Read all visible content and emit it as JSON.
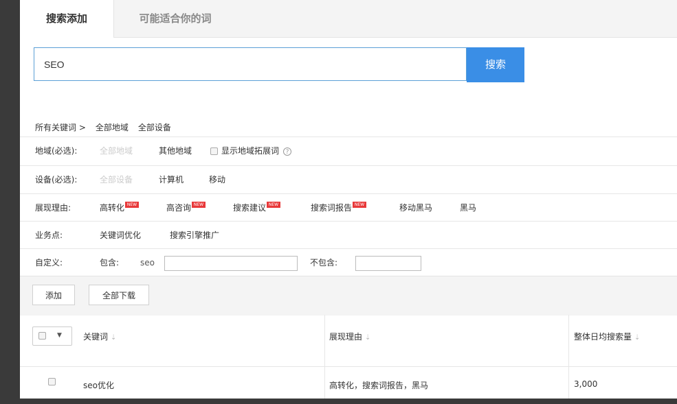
{
  "tabs": [
    {
      "label": "搜索添加"
    },
    {
      "label": "可能适合你的词"
    }
  ],
  "search": {
    "value": "SEO",
    "button_label": "搜索"
  },
  "breadcrumb": [
    "所有关键词 >",
    "全部地域",
    "全部设备"
  ],
  "filters": {
    "region": {
      "label": "地域(必选):",
      "all": "全部地域",
      "other": "其他地域",
      "show_expand": "显示地域拓展词"
    },
    "device": {
      "label": "设备(必选):",
      "all": "全部设备",
      "pc": "计算机",
      "mobile": "移动"
    },
    "reason": {
      "label": "展现理由:",
      "items": [
        "高转化",
        "高咨询",
        "搜索建议",
        "搜索词报告",
        "移动黑马",
        "黑马"
      ]
    },
    "business": {
      "label": "业务点:",
      "items": [
        "关键词优化",
        "搜索引擎推广"
      ]
    },
    "custom": {
      "label": "自定义:",
      "include_label": "包含:",
      "include_value": "seo",
      "exclude_label": "不包含:"
    }
  },
  "toolbar": {
    "add_label": "添加",
    "download_label": "全部下载"
  },
  "table": {
    "columns": [
      "关键词",
      "展现理由",
      "整体日均搜索量"
    ],
    "rows": [
      {
        "keyword": "seo优化",
        "reason": "高转化，搜索词报告，黑马",
        "volume": "3,000"
      }
    ]
  },
  "colors": {
    "accent": "#3a8ee6",
    "badge": "#e8393a"
  },
  "icons": {
    "new_badge": "NEW",
    "help": "?",
    "sort": "⇣",
    "caret": "▼"
  }
}
